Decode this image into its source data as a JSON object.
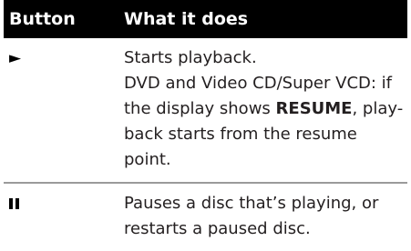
{
  "table": {
    "headers": {
      "button": "Button",
      "description": "What it does"
    },
    "rows": [
      {
        "button_icon": "play-icon",
        "button_symbol": "►",
        "lines": [
          "Starts playback.",
          "DVD and Video CD/Super VCD: if",
          "the display shows ",
          "RESUME",
          ", play-",
          "back starts from the resume",
          "point."
        ]
      },
      {
        "button_icon": "pause-icon",
        "lines": [
          "Pauses a disc that’s playing, or",
          "restarts a paused disc."
        ]
      }
    ]
  }
}
